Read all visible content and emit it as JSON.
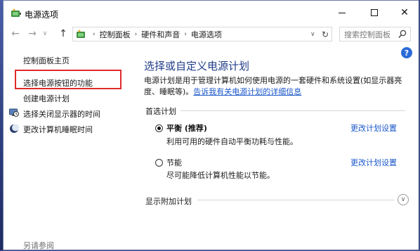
{
  "window": {
    "title": "电源选项"
  },
  "titlebar": {
    "minimize_glyph": "",
    "maximize_glyph": "",
    "close_glyph": "✕"
  },
  "nav": {
    "back_glyph": "←",
    "forward_glyph": "→",
    "dropdown_glyph": "∨",
    "up_glyph": "↑",
    "breadcrumbs": [
      "控制面板",
      "硬件和声音",
      "电源选项"
    ],
    "separator": "›",
    "address_dropdown_glyph": "∨",
    "refresh_glyph": "↻",
    "search_placeholder": "搜索控制面板"
  },
  "help": {
    "glyph": "?"
  },
  "sidebar": {
    "home": "控制面板主页",
    "items": [
      {
        "label": "选择电源按钮的功能",
        "icon": null
      },
      {
        "label": "创建电源计划",
        "icon": null
      },
      {
        "label": "选择关闭显示器的时间",
        "icon": "monitor-clock-icon"
      },
      {
        "label": "更改计算机睡眠时间",
        "icon": "moon-icon"
      }
    ],
    "see_also": "另请参阅"
  },
  "main": {
    "title": "选择或自定义电源计划",
    "desc_line1": "电源计划是用于管理计算机如何使用电源的一套硬件和系统设置(如显示器亮",
    "desc_line2_prefix": "度、睡眠等)。",
    "desc_link": "告诉我有关电源计划的详细信息",
    "preferred_label": "首选计划",
    "plans": [
      {
        "name": "平衡 (推荐)",
        "desc": "利用可用的硬件自动平衡功耗与性能。",
        "change": "更改计划设置",
        "selected": true
      },
      {
        "name": "节能",
        "desc": "尽可能降低计算机性能以节能。",
        "change": "更改计划设置",
        "selected": false
      }
    ],
    "more_plans_label": "显示附加计划",
    "expand_glyph": "∨"
  },
  "colors": {
    "title_blue": "#1f3c88",
    "link_blue": "#1a57c9",
    "highlight_red": "#e02a2a",
    "help_blue": "#2a6bd6"
  }
}
